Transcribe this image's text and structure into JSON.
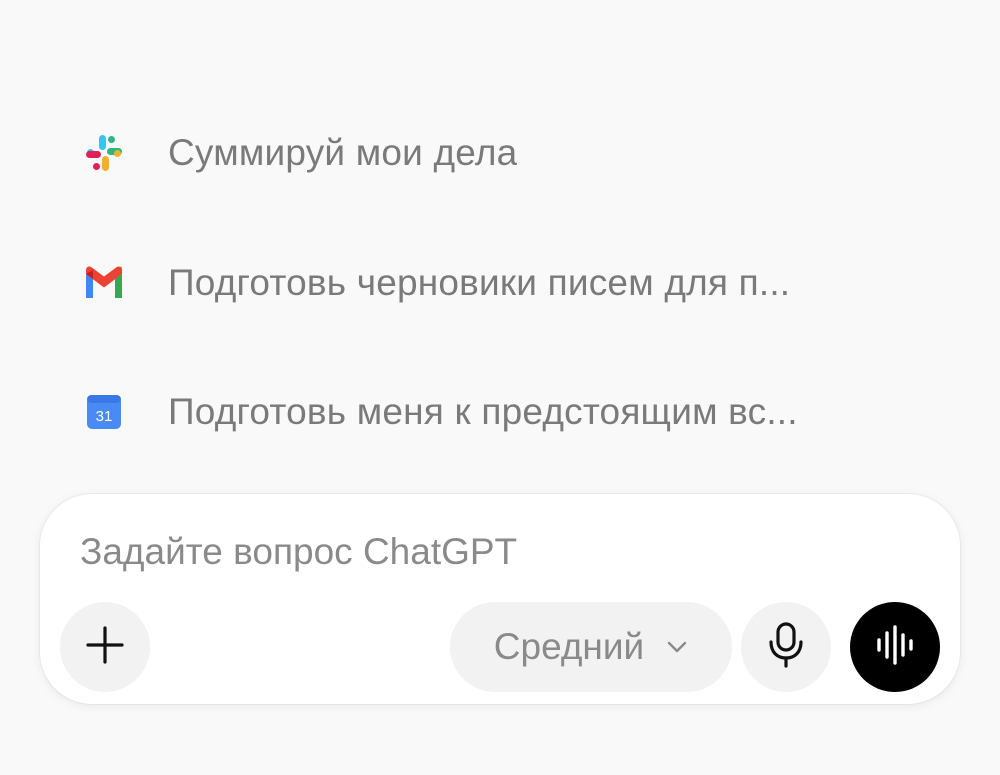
{
  "suggestions": [
    {
      "app_icon": "slack-icon",
      "label": "Суммируй мои дела"
    },
    {
      "app_icon": "gmail-icon",
      "label": "Подготовь черновики писем для п..."
    },
    {
      "app_icon": "calendar-icon",
      "label": "Подготовь меня к предстоящим вс...",
      "calendar_day": "31"
    }
  ],
  "composer": {
    "placeholder": "Задайте вопрос ChatGPT",
    "value": "",
    "model_selector": {
      "label": "Средний",
      "icon": "chevron-down-icon"
    },
    "buttons": {
      "attach_icon": "plus-icon",
      "dictate_icon": "microphone-icon",
      "voice_mode_icon": "voice-waveform-icon"
    }
  },
  "colors": {
    "background": "#f9f9f9",
    "suggestion_text": "#7a7a7a",
    "composer_bg": "#ffffff",
    "button_bg": "#f2f2f2",
    "voice_button_bg": "#000000",
    "placeholder": "#8a8a8a"
  }
}
